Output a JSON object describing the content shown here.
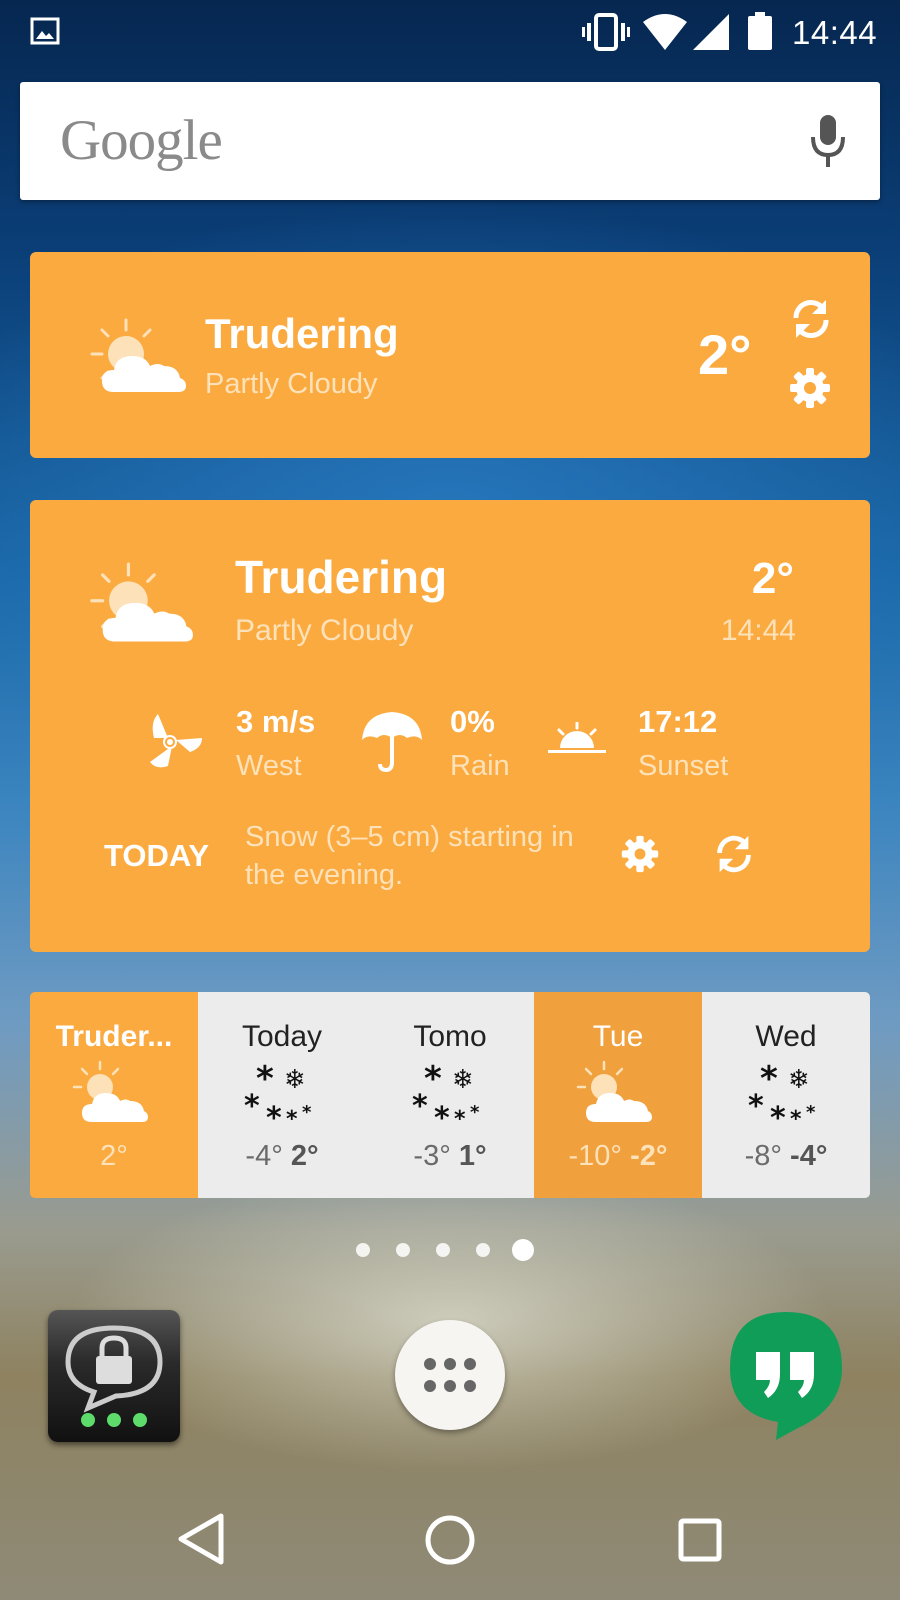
{
  "status_bar": {
    "time": "14:44",
    "icons": [
      "gallery-icon",
      "vibrate-icon",
      "wifi-icon",
      "signal-icon",
      "battery-icon"
    ]
  },
  "search": {
    "logo": "Google",
    "icon": "mic-icon"
  },
  "widget_small": {
    "city": "Trudering",
    "condition": "Partly Cloudy",
    "temperature": "2°",
    "icons": [
      "partly-cloudy-icon",
      "refresh-icon",
      "gear-icon"
    ]
  },
  "widget_large": {
    "city": "Trudering",
    "condition": "Partly Cloudy",
    "temperature": "2°",
    "time": "14:44",
    "wind": {
      "value": "3 m/s",
      "label": "West",
      "icon": "wind-icon"
    },
    "rain": {
      "value": "0%",
      "label": "Rain",
      "icon": "umbrella-icon"
    },
    "sunset": {
      "value": "17:12",
      "label": "Sunset",
      "icon": "sunset-icon"
    },
    "today_label": "TODAY",
    "forecast_text": "Snow (3–5 cm) starting in the evening."
  },
  "forecast_strip": [
    {
      "day": "Truder...",
      "low": "2°",
      "high": "",
      "icon": "partly-cloudy-icon"
    },
    {
      "day": "Today",
      "low": "-4°",
      "high": "2°",
      "icon": "snow-icon"
    },
    {
      "day": "Tomo",
      "low": "-3°",
      "high": "1°",
      "icon": "snow-icon"
    },
    {
      "day": "Tue",
      "low": "-10°",
      "high": "-2°",
      "icon": "partly-cloudy-icon"
    },
    {
      "day": "Wed",
      "low": "-8°",
      "high": "-4°",
      "icon": "snow-icon"
    }
  ],
  "page_indicator": {
    "count": 5,
    "active": 5
  },
  "dock": [
    "threema-app-icon",
    "app-drawer-icon",
    "hangouts-app-icon"
  ],
  "nav_bar": [
    "back-icon",
    "home-icon",
    "recents-icon"
  ],
  "colors": {
    "widget_orange": "#fbaa40",
    "widget_dark_orange": "#f0a03c",
    "forecast_cell_light": "#ececec",
    "hangouts_green": "#0f9d58"
  }
}
